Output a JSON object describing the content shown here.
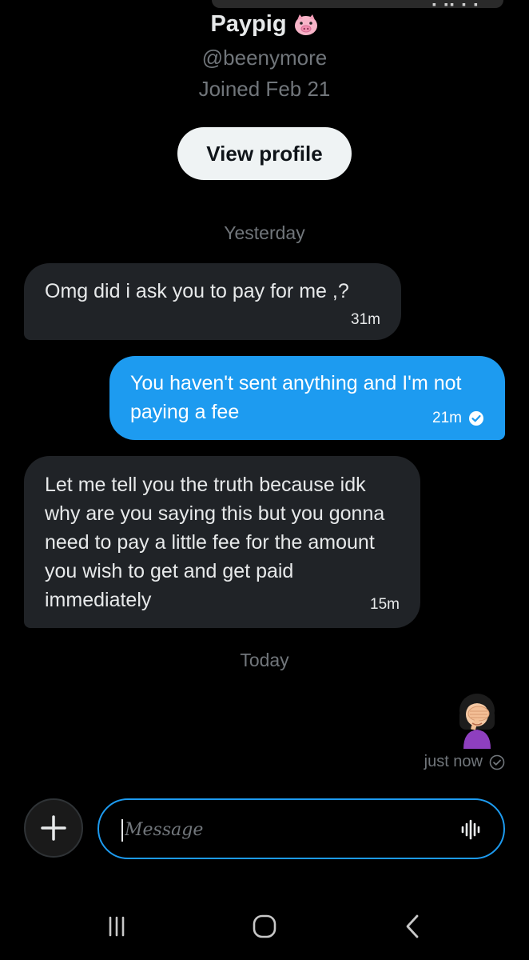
{
  "header": {
    "display_name": "Paypig",
    "name_emoji": "pig-face-icon",
    "handle": "@beenymore",
    "joined": "Joined Feb 21",
    "view_profile_label": "View profile"
  },
  "conversation": {
    "separators": [
      "Yesterday",
      "Today"
    ],
    "messages": [
      {
        "direction": "incoming",
        "text": "Omg did i ask you to pay for me ,?",
        "time": "31m"
      },
      {
        "direction": "outgoing",
        "text": "You haven't sent anything and I'm not paying a fee",
        "time": "21m",
        "status_icon": "check-circle-icon"
      },
      {
        "direction": "incoming",
        "text": "Let me tell you the truth because idk why are you saying this but you gonna need to pay a little fee for the amount you wish to get and get paid immediately",
        "time": "15m"
      },
      {
        "direction": "outgoing",
        "emoji": "woman-facepalming-icon",
        "time": "just now",
        "status_icon": "check-circle-outline-icon"
      }
    ]
  },
  "composer": {
    "add_icon": "plus-icon",
    "placeholder": "Message",
    "voice_icon": "waveform-icon"
  },
  "system_nav": {
    "recents_icon": "recents-icon",
    "home_icon": "home-icon",
    "back_icon": "back-chevron-icon"
  },
  "colors": {
    "background": "#000000",
    "incoming_bubble": "#202327",
    "outgoing_bubble": "#1d9bf0",
    "secondary_text": "#71767b",
    "accent": "#1d9bf0"
  }
}
